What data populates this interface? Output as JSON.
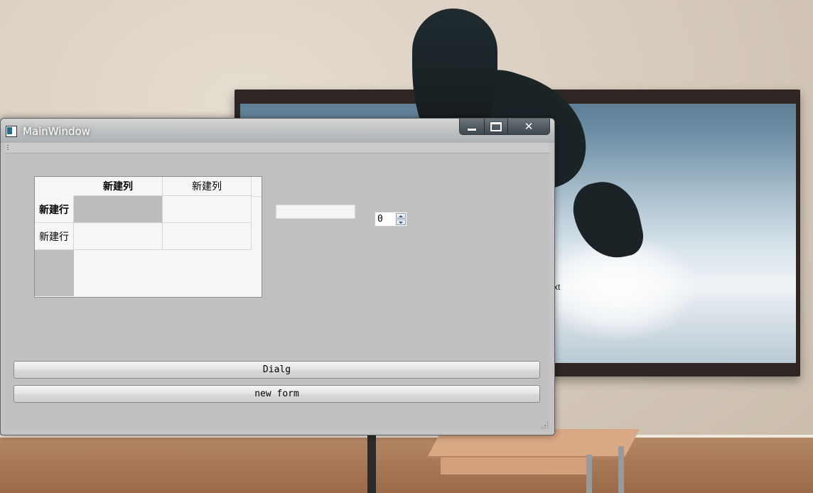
{
  "window": {
    "title": "MainWindow"
  },
  "table": {
    "columns": [
      "新建列",
      "新建列"
    ],
    "rows": [
      "新建行",
      "新建行"
    ]
  },
  "line_edit": {
    "value": ""
  },
  "spinbox": {
    "value": "0"
  },
  "buttons": {
    "dialog_label": "Dialg",
    "new_form_label": "new form"
  },
  "background": {
    "stray_text": "xt"
  },
  "colors": {
    "window_bg": "#c0c0c0",
    "table_bg": "#f6f6f8",
    "selection": "#bcbcbc"
  }
}
